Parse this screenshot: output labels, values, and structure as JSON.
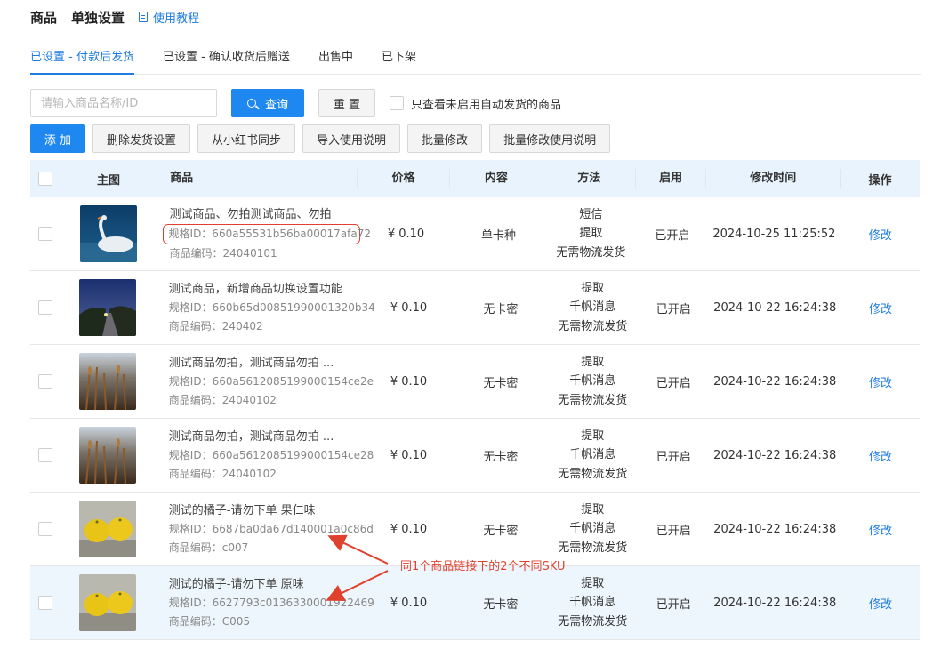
{
  "header": {
    "title_part1": "商品",
    "title_part2": "单独设置",
    "tutorial_link": "使用教程",
    "tutorial_icon": "document-icon"
  },
  "tabs": [
    {
      "label": "已设置 - 付款后发货",
      "active": true
    },
    {
      "label": "已设置 - 确认收货后赠送",
      "active": false
    },
    {
      "label": "出售中",
      "active": false
    },
    {
      "label": "已下架",
      "active": false
    }
  ],
  "search": {
    "placeholder": "请输入商品名称/ID",
    "value": "",
    "query_label": "查询",
    "reset_label": "重 置",
    "only_disabled_label": "只查看未启用自动发货的商品"
  },
  "actions": {
    "add": "添 加",
    "delete_settings": "删除发货设置",
    "sync_xiaohongshu": "从小红书同步",
    "import_guide": "导入使用说明",
    "batch_edit": "批量修改",
    "batch_edit_guide": "批量修改使用说明"
  },
  "table": {
    "headers": {
      "image": "主图",
      "goods": "商品",
      "price": "价格",
      "content": "内容",
      "method": "方法",
      "enabled": "启用",
      "modified_time": "修改时间",
      "operation": "操作"
    },
    "rows": [
      {
        "title": "测试商品、勿拍测试商品、勿拍",
        "sku_id": "规格ID：660a55531b56ba00017afa72",
        "code": "商品编码：24040101",
        "price": "¥ 0.10",
        "content": "单卡种",
        "method": [
          "短信",
          "提取",
          "无需物流发货"
        ],
        "enabled": "已开启",
        "time": "2024-10-25 11:25:52",
        "op": "修改",
        "image": "swan"
      },
      {
        "title": "测试商品，新增商品切换设置功能",
        "sku_id": "规格ID：660b65d00851990001320b34",
        "code": "商品编码：240402",
        "price": "¥ 0.10",
        "content": "无卡密",
        "method": [
          "提取",
          "千帆消息",
          "无需物流发货"
        ],
        "enabled": "已开启",
        "time": "2024-10-22 16:24:38",
        "op": "修改",
        "image": "dusk-road"
      },
      {
        "title": "测试商品勿拍，测试商品勿拍 ...",
        "sku_id": "规格ID：660a5612085199000154ce2e",
        "code": "商品编码：24040102",
        "price": "¥ 0.10",
        "content": "无卡密",
        "method": [
          "提取",
          "千帆消息",
          "无需物流发货"
        ],
        "enabled": "已开启",
        "time": "2024-10-22 16:24:38",
        "op": "修改",
        "image": "reeds"
      },
      {
        "title": "测试商品勿拍，测试商品勿拍 ...",
        "sku_id": "规格ID：660a5612085199000154ce28",
        "code": "商品编码：24040102",
        "price": "¥ 0.10",
        "content": "无卡密",
        "method": [
          "提取",
          "千帆消息",
          "无需物流发货"
        ],
        "enabled": "已开启",
        "time": "2024-10-22 16:24:38",
        "op": "修改",
        "image": "reeds"
      },
      {
        "title": "测试的橘子-请勿下单 果仁味",
        "sku_id": "规格ID：6687ba0da67d140001a0c86d",
        "code": "商品编码：c007",
        "price": "¥ 0.10",
        "content": "无卡密",
        "method": [
          "提取",
          "千帆消息",
          "无需物流发货"
        ],
        "enabled": "已开启",
        "time": "2024-10-22 16:24:38",
        "op": "修改",
        "image": "oranges"
      },
      {
        "title": "测试的橘子-请勿下单 原味",
        "sku_id": "规格ID：6627793c0136330001922469",
        "code": "商品编码：C005",
        "price": "¥ 0.10",
        "content": "无卡密",
        "method": [
          "提取",
          "千帆消息",
          "无需物流发货"
        ],
        "enabled": "已开启",
        "time": "2024-10-22 16:24:38",
        "op": "修改",
        "image": "oranges"
      }
    ]
  },
  "annotation": {
    "text": "同1个商品链接下的2个不同SKU",
    "color": "#e0412e"
  },
  "colors": {
    "accent": "#1e88f0",
    "link": "#1e7be0",
    "header_bg": "#e9f3fd",
    "annotation": "#e0412e"
  }
}
